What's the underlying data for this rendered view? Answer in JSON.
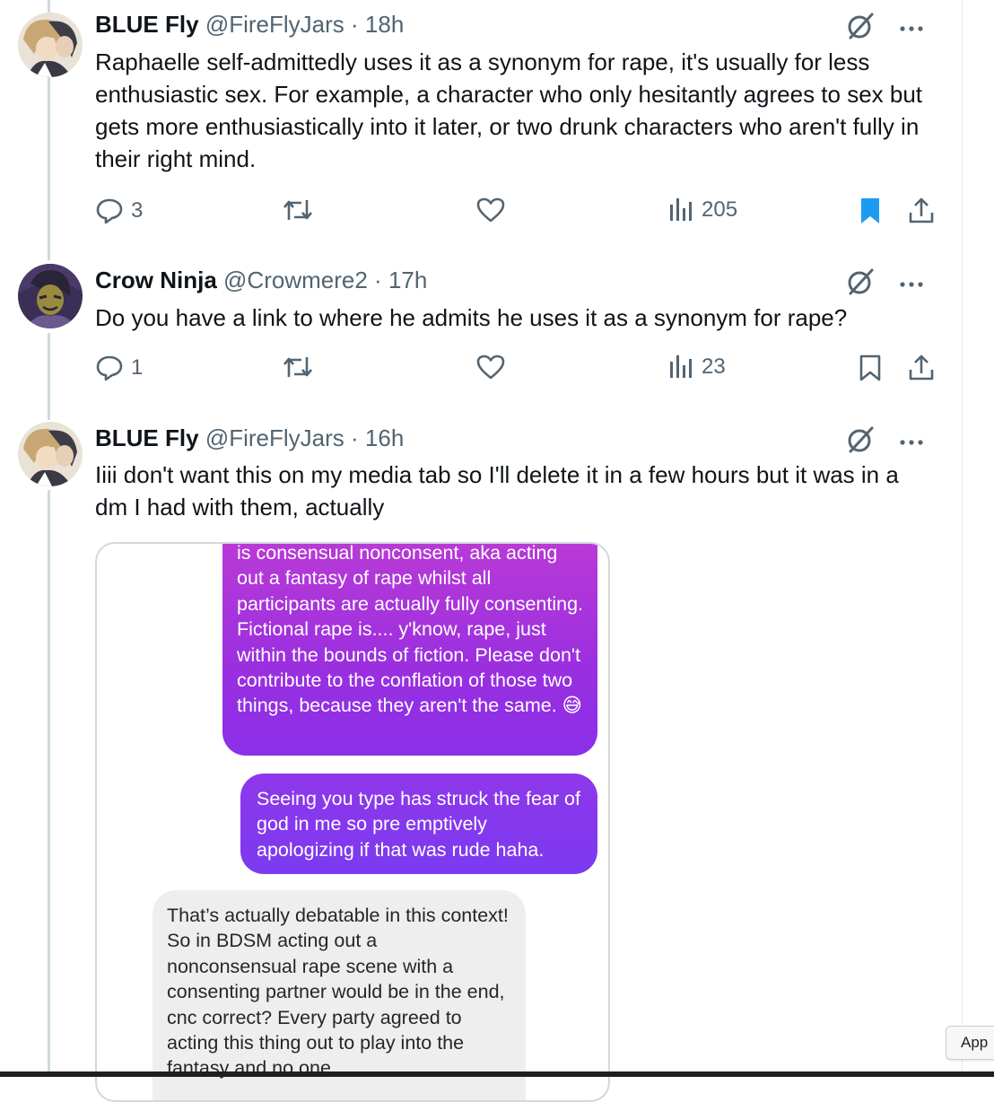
{
  "tweets": [
    {
      "name": "BLUE Fly",
      "handle": "@FireFlyJars",
      "dot": "·",
      "time": "18h",
      "text": "Raphaelle self-admittedly uses it as a synonym for rape, it's usually for less enthusiastic sex. For example, a character who only hesitantly agrees to sex but gets more enthusiastically into it later, or two drunk characters who aren't fully in their right mind.",
      "replies": "3",
      "views": "205",
      "bookmarked": true
    },
    {
      "name": "Crow Ninja",
      "handle": "@Crowmere2",
      "dot": "·",
      "time": "17h",
      "text": "Do you have a link to where he admits he uses it as a synonym for rape?",
      "replies": "1",
      "views": "23",
      "bookmarked": false
    },
    {
      "name": "BLUE Fly",
      "handle": "@FireFlyJars",
      "dot": "·",
      "time": "16h",
      "text": "Iiii don't want this on my media tab so I'll delete it in a few hours but it was in a dm I had with them, actually"
    }
  ],
  "media": {
    "bubble1": "is consensual nonconsent, aka acting out a fantasy of rape whilst all participants are actually fully consenting. Fictional rape is.... y'know, rape, just within the bounds of fiction. Please don't contribute to the conflation of those two things, because they aren't the same. 😅",
    "bubble2": "Seeing you type has struck the fear of god in me so pre emptively apologizing if that was rude haha.",
    "bubble3": "That’s actually debatable in this context! So in BDSM acting out a nonconsensual rape scene with a consenting partner would be in the end, cnc correct? Every party agreed to acting this thing out to play into the fantasy and no one"
  },
  "app_button": "App",
  "colors": {
    "accent": "#1d9bf0",
    "secondary_text": "#536471",
    "thread_line": "#cfd9de"
  }
}
